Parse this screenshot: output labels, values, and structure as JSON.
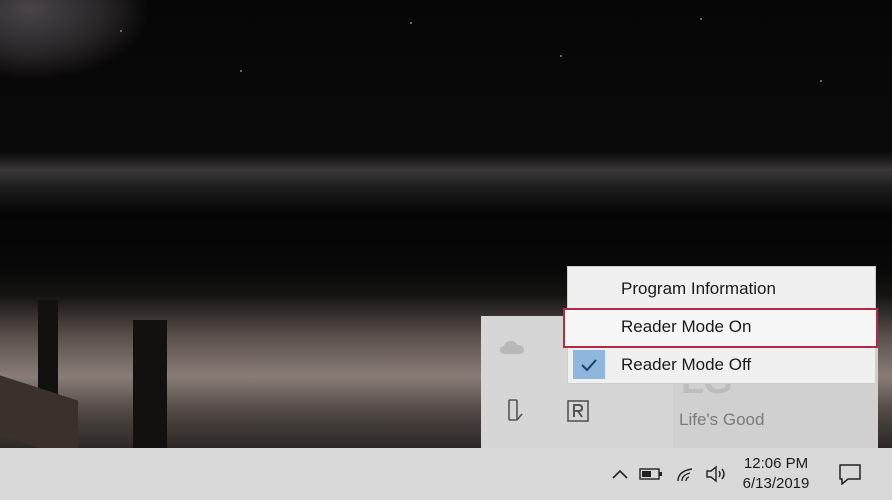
{
  "context_menu": {
    "items": [
      {
        "label": "Program Information"
      },
      {
        "label": "Reader Mode On",
        "highlighted": true
      },
      {
        "label": "Reader Mode Off",
        "checked": true
      }
    ]
  },
  "lg_panel": {
    "logo": "LG",
    "tagline": "Life's Good"
  },
  "tray_icons": [
    "onedrive-icon",
    "usb-drive-icon",
    "reader-app-icon"
  ],
  "taskbar": {
    "time": "12:06 PM",
    "date": "6/13/2019",
    "icons": [
      "chevron-up-icon",
      "battery-icon",
      "wifi-icon",
      "volume-icon",
      "notification-icon"
    ]
  },
  "colors": {
    "highlight_border": "#b22a45",
    "checkmark_bg": "#8fb6dc",
    "taskbar_bg": "#d9d9d9"
  }
}
